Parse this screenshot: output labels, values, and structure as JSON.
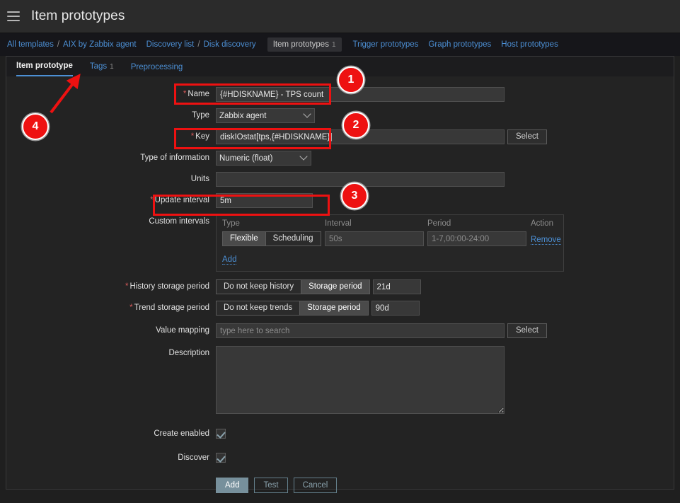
{
  "header": {
    "menu_icon": "hamburger-icon",
    "title": "Item prototypes"
  },
  "breadcrumb": {
    "items": [
      {
        "label": "All templates",
        "sep": "/"
      },
      {
        "label": "AIX by Zabbix agent",
        "sep": ""
      },
      {
        "label": "Discovery list",
        "sep": "/"
      },
      {
        "label": "Disk discovery",
        "sep": ""
      }
    ],
    "active": {
      "label": "Item prototypes",
      "count": "1"
    },
    "rest": [
      {
        "label": "Trigger prototypes"
      },
      {
        "label": "Graph prototypes"
      },
      {
        "label": "Host prototypes"
      }
    ]
  },
  "tabs": [
    {
      "label": "Item prototype",
      "count": "",
      "selected": true
    },
    {
      "label": "Tags",
      "count": "1",
      "selected": false
    },
    {
      "label": "Preprocessing",
      "count": "",
      "selected": false
    }
  ],
  "form": {
    "name": {
      "label": "Name",
      "required": true,
      "value": "{#HDISKNAME} - TPS count",
      "placeholder": ""
    },
    "type": {
      "label": "Type",
      "value": "Zabbix agent",
      "options": [
        "Zabbix agent"
      ]
    },
    "key": {
      "label": "Key",
      "required": true,
      "value": "diskIOstat[tps,{#HDISKNAME}]",
      "placeholder": "",
      "select_button": "Select"
    },
    "type_of_information": {
      "label": "Type of information",
      "value": "Numeric (float)",
      "options": [
        "Numeric (float)"
      ]
    },
    "units": {
      "label": "Units",
      "value": "",
      "placeholder": ""
    },
    "update_interval": {
      "label": "Update interval",
      "required": true,
      "value": "5m",
      "placeholder": ""
    },
    "custom_intervals": {
      "label": "Custom intervals",
      "columns": [
        "Type",
        "Interval",
        "Period",
        "Action"
      ],
      "rows": [
        {
          "type_options": [
            "Flexible",
            "Scheduling"
          ],
          "type_selected": "Flexible",
          "interval_value": "",
          "interval_placeholder": "50s",
          "period_value": "",
          "period_placeholder": "1-7,00:00-24:00",
          "action": "Remove"
        }
      ],
      "add_link": "Add"
    },
    "history_storage_period": {
      "label": "History storage period",
      "required": true,
      "options": [
        "Do not keep history",
        "Storage period"
      ],
      "selected": "Storage period",
      "value": "21d"
    },
    "trend_storage_period": {
      "label": "Trend storage period",
      "required": true,
      "options": [
        "Do not keep trends",
        "Storage period"
      ],
      "selected": "Storage period",
      "value": "90d"
    },
    "value_mapping": {
      "label": "Value mapping",
      "value": "",
      "placeholder": "type here to search",
      "select_button": "Select"
    },
    "description": {
      "label": "Description",
      "value": "",
      "placeholder": ""
    },
    "create_enabled": {
      "label": "Create enabled",
      "checked": true
    },
    "discover": {
      "label": "Discover",
      "checked": true
    }
  },
  "footer": {
    "add": "Add",
    "test": "Test",
    "cancel": "Cancel"
  },
  "annotations": {
    "markers": [
      {
        "number": "1"
      },
      {
        "number": "2"
      },
      {
        "number": "3"
      },
      {
        "number": "4"
      }
    ],
    "color": "#ee1111"
  }
}
